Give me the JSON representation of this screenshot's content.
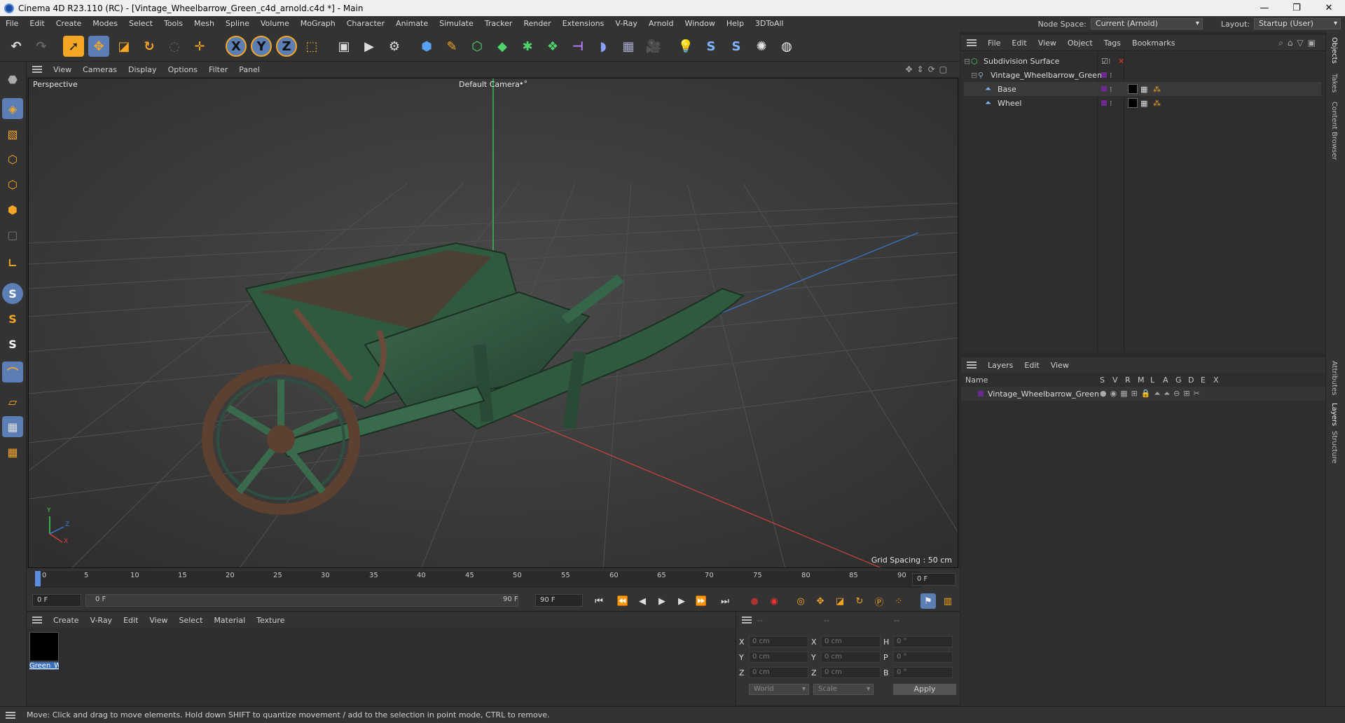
{
  "window": {
    "title": "Cinema 4D R23.110 (RC) - [Vintage_Wheelbarrow_Green_c4d_arnold.c4d *] - Main",
    "minimize": "—",
    "maximize": "❐",
    "close": "✕"
  },
  "menubar": {
    "items": [
      "File",
      "Edit",
      "Create",
      "Modes",
      "Select",
      "Tools",
      "Mesh",
      "Spline",
      "Volume",
      "MoGraph",
      "Character",
      "Animate",
      "Simulate",
      "Tracker",
      "Render",
      "Extensions",
      "V-Ray",
      "Arnold",
      "Window",
      "Help",
      "3DToAll"
    ],
    "node_space_label": "Node Space:",
    "node_space_value": "Current (Arnold)",
    "layout_label": "Layout:",
    "layout_value": "Startup (User)"
  },
  "toolbar": {
    "axis_x": "X",
    "axis_y": "Y",
    "axis_z": "Z"
  },
  "viewport_menu": {
    "items": [
      "View",
      "Cameras",
      "Display",
      "Options",
      "Filter",
      "Panel"
    ]
  },
  "viewport": {
    "view_name": "Perspective",
    "camera_name": "Default Camera",
    "camera_symbol": "•°",
    "grid_spacing": "Grid Spacing : 50 cm",
    "axis_y": "Y",
    "axis_z": "Z",
    "axis_x": "X"
  },
  "timeline": {
    "ticks": [
      "0",
      "5",
      "10",
      "15",
      "20",
      "25",
      "30",
      "35",
      "40",
      "45",
      "50",
      "55",
      "60",
      "65",
      "70",
      "75",
      "80",
      "85",
      "90"
    ],
    "current_frame": "0 F"
  },
  "transport": {
    "start_field": "0 F",
    "range_start": "0 F",
    "range_end": "90 F",
    "end_field": "90 F"
  },
  "material_menu": {
    "items": [
      "Create",
      "V-Ray",
      "Edit",
      "View",
      "Select",
      "Material",
      "Texture"
    ]
  },
  "materials": [
    {
      "name": "Green_W",
      "color": "#000000"
    }
  ],
  "coordinates": {
    "header": [
      "--",
      "--",
      "--"
    ],
    "rows": [
      {
        "a_label": "X",
        "a_val": "0 cm",
        "b_label": "X",
        "b_val": "0 cm",
        "c_label": "H",
        "c_val": "0 °"
      },
      {
        "a_label": "Y",
        "a_val": "0 cm",
        "b_label": "Y",
        "b_val": "0 cm",
        "c_label": "P",
        "c_val": "0 °"
      },
      {
        "a_label": "Z",
        "a_val": "0 cm",
        "b_label": "Z",
        "b_val": "0 cm",
        "c_label": "B",
        "c_val": "0 °"
      }
    ],
    "mode_world": "World",
    "mode_scale": "Scale",
    "apply_label": "Apply"
  },
  "object_menu": {
    "items": [
      "File",
      "Edit",
      "View",
      "Object",
      "Tags",
      "Bookmarks"
    ]
  },
  "objects": [
    {
      "name": "Subdivision Surface"
    },
    {
      "name": "Vintage_Wheelbarrow_Green"
    },
    {
      "name": "Base"
    },
    {
      "name": "Wheel"
    }
  ],
  "layer_menu": {
    "items": [
      "Layers",
      "Edit",
      "View"
    ]
  },
  "layers": {
    "name_header": "Name",
    "columns": [
      "S",
      "V",
      "R",
      "M",
      "L",
      "A",
      "G",
      "D",
      "E",
      "X"
    ],
    "rows": [
      {
        "name": "Vintage_Wheelbarrow_Green",
        "color": "#6a2b8c"
      }
    ]
  },
  "side_tabs": [
    "Objects",
    "Takes",
    "Content Browser",
    "Attributes",
    "Layers",
    "Structure"
  ],
  "status_text": "Move: Click and drag to move elements. Hold down SHIFT to quantize movement / add to the selection in point mode, CTRL to remove.",
  "colors": {
    "accent_orange": "#f5a623",
    "accent_blue": "#2f7ad8",
    "layer_purple": "#6a2b8c"
  }
}
